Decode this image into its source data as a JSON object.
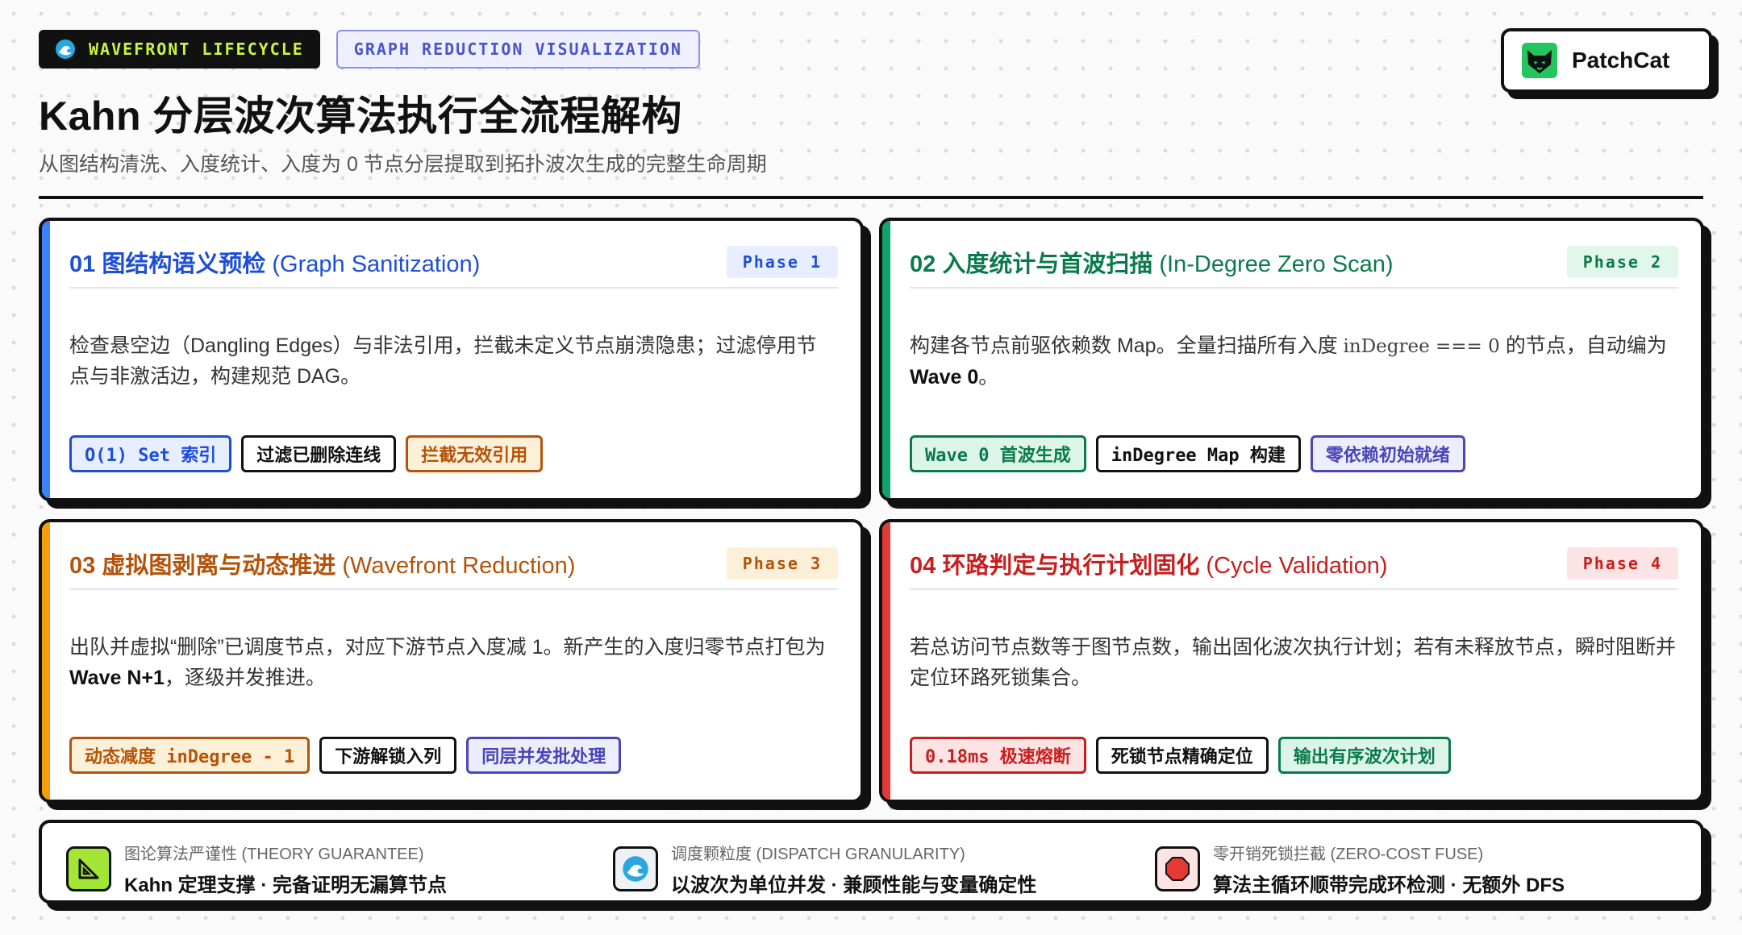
{
  "header": {
    "badge_primary": "WAVEFRONT LIFECYCLE",
    "badge_secondary": "GRAPH REDUCTION VISUALIZATION",
    "title": "Kahn 分层波次算法执行全流程解构",
    "subtitle": "从图结构清洗、入度统计、入度为 0 节点分层提取到拓扑波次生成的完整生命周期",
    "logo_text": "PatchCat"
  },
  "cards": [
    {
      "title_cn": "01 图结构语义预检 ",
      "title_en": "(Graph Sanitization)",
      "phase": "Phase 1",
      "desc_a": "检查悬空边（Dangling Edges）与非法引用，拦截未定义节点崩溃隐患；过滤停用节点与非激活边，构建规范 DAG。",
      "tags": [
        "O(1) Set 索引",
        "过滤已删除连线",
        "拦截无效引用"
      ]
    },
    {
      "title_cn": "02 入度统计与首波扫描 ",
      "title_en": "(In-Degree Zero Scan)",
      "phase": "Phase 2",
      "desc_a": "构建各节点前驱依赖数 Map。全量扫描所有入度 ",
      "desc_code": "inDegree === 0",
      "desc_b": " 的节点，自动编为 ",
      "desc_bold": "Wave 0",
      "desc_c": "。",
      "tags": [
        "Wave 0 首波生成",
        "inDegree Map 构建",
        "零依赖初始就绪"
      ]
    },
    {
      "title_cn": "03 虚拟图剥离与动态推进 ",
      "title_en": "(Wavefront Reduction)",
      "phase": "Phase 3",
      "desc_a": "出队并虚拟“删除”已调度节点，对应下游节点入度减 1。新产生的入度归零节点打包为 ",
      "desc_bold": "Wave N+1",
      "desc_c": "，逐级并发推进。",
      "tags": [
        "动态减度 inDegree - 1",
        "下游解锁入列",
        "同层并发批处理"
      ]
    },
    {
      "title_cn": "04 环路判定与执行计划固化 ",
      "title_en": "(Cycle Validation)",
      "phase": "Phase 4",
      "desc_a": "若总访问节点数等于图节点数，输出固化波次执行计划；若有未释放节点，瞬时阻断并定位环路死锁集合。",
      "tags": [
        "0.18ms 极速熔断",
        "死锁节点精确定位",
        "输出有序波次计划"
      ]
    }
  ],
  "footer": [
    {
      "label": "图论算法严谨性 (THEORY GUARANTEE)",
      "value": "Kahn 定理支撑 · 完备证明无漏算节点",
      "icon": "triangle-ruler-icon"
    },
    {
      "label": "调度颗粒度 (DISPATCH GRANULARITY)",
      "value": "以波次为单位并发 · 兼顾性能与变量确定性",
      "icon": "wave-icon"
    },
    {
      "label": "零开销死锁拦截 (ZERO-COST FUSE)",
      "value": "算法主循环顺带完成环检测 · 无额外 DFS",
      "icon": "stop-octagon-icon"
    }
  ],
  "colors": {
    "blue": "#1d4ed8",
    "green": "#0a7a4c",
    "amber": "#b45309",
    "red": "#c81e1e",
    "lime": "#c8f542"
  }
}
